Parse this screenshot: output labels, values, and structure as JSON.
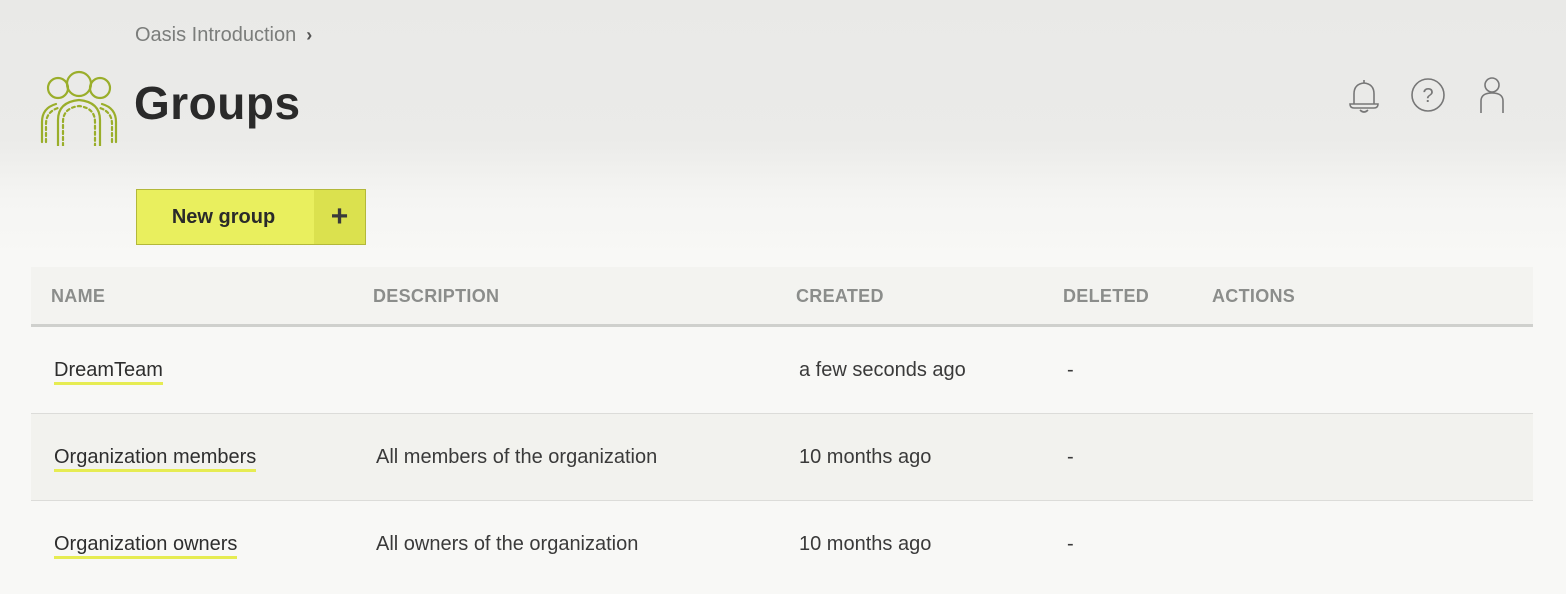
{
  "breadcrumb": {
    "parent": "Oasis Introduction",
    "separator": "›"
  },
  "page": {
    "title": "Groups"
  },
  "header_icons": [
    "bell-icon",
    "help-icon",
    "user-icon"
  ],
  "actions": {
    "new_group_label": "New group",
    "new_group_icon": "+"
  },
  "table": {
    "columns": [
      "NAME",
      "DESCRIPTION",
      "CREATED",
      "DELETED",
      "ACTIONS"
    ],
    "rows": [
      {
        "name": "DreamTeam",
        "description": "",
        "created": "a few seconds ago",
        "deleted": "-"
      },
      {
        "name": "Organization members",
        "description": "All members of the organization",
        "created": "10 months ago",
        "deleted": "-"
      },
      {
        "name": "Organization owners",
        "description": "All owners of the organization",
        "created": "10 months ago",
        "deleted": "-"
      }
    ]
  },
  "colors": {
    "accent": "#e9ef5e",
    "accent_border": "#b3b83a",
    "link_underline": "#e6ec52",
    "logo": "#9aae2a"
  }
}
